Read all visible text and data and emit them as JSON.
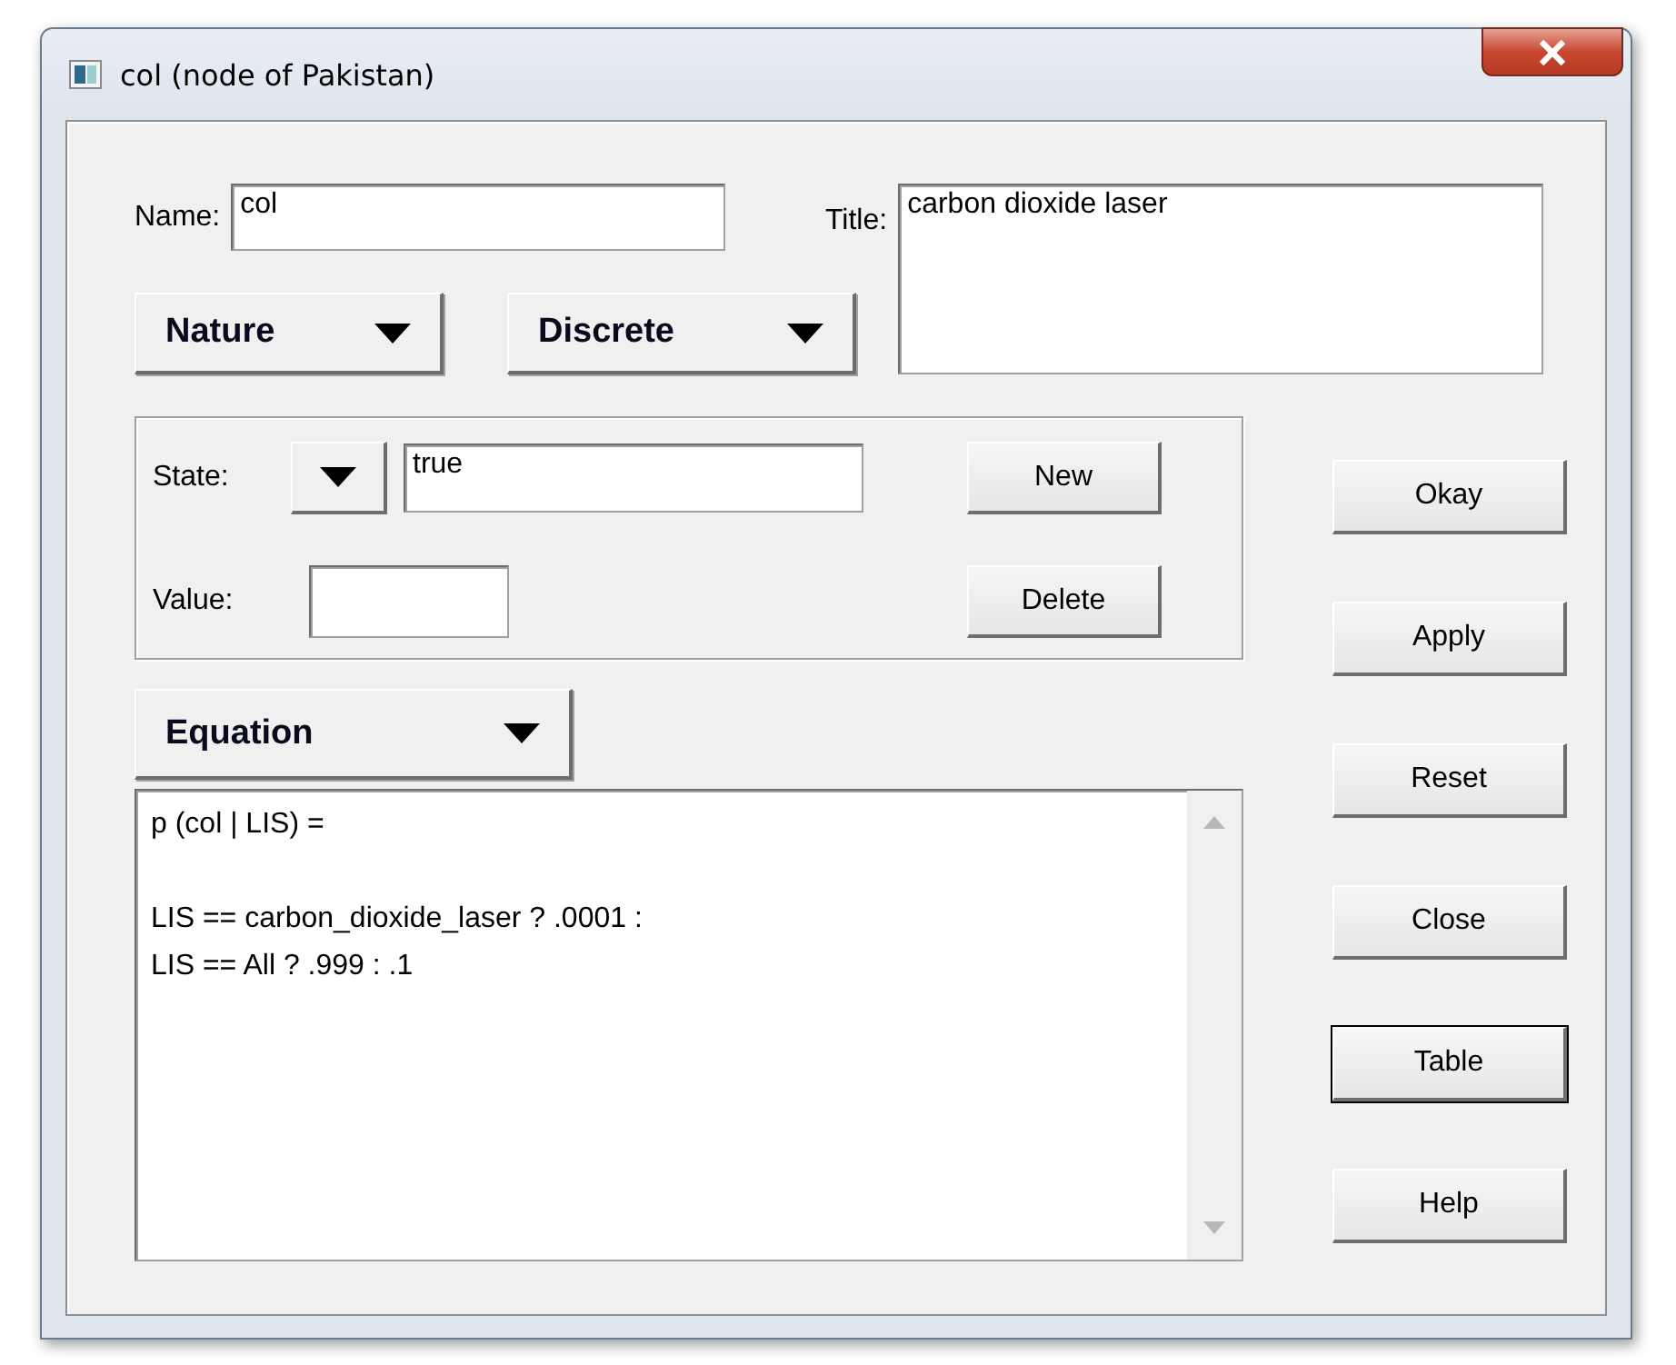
{
  "window": {
    "title": "col (node of Pakistan)"
  },
  "name": {
    "label": "Name:",
    "value": "col"
  },
  "title": {
    "label": "Title:",
    "value": "carbon dioxide laser"
  },
  "dropdowns": [
    "Nature",
    "Discrete"
  ],
  "state": {
    "label": "State:",
    "value": "true"
  },
  "value": {
    "label": "Value:"
  },
  "state_buttons": [
    "New",
    "Delete"
  ],
  "equation_menu": "Equation",
  "equation": "p (col | LIS) =\n\nLIS == carbon_dioxide_laser ? .0001 :\nLIS == All ? .999 : .1",
  "buttons": [
    {
      "label": "Okay",
      "default": false
    },
    {
      "label": "Apply",
      "default": false
    },
    {
      "label": "Reset",
      "default": false
    },
    {
      "label": "Close",
      "default": false
    },
    {
      "label": "Table",
      "default": true
    },
    {
      "label": "Help",
      "default": false
    }
  ]
}
